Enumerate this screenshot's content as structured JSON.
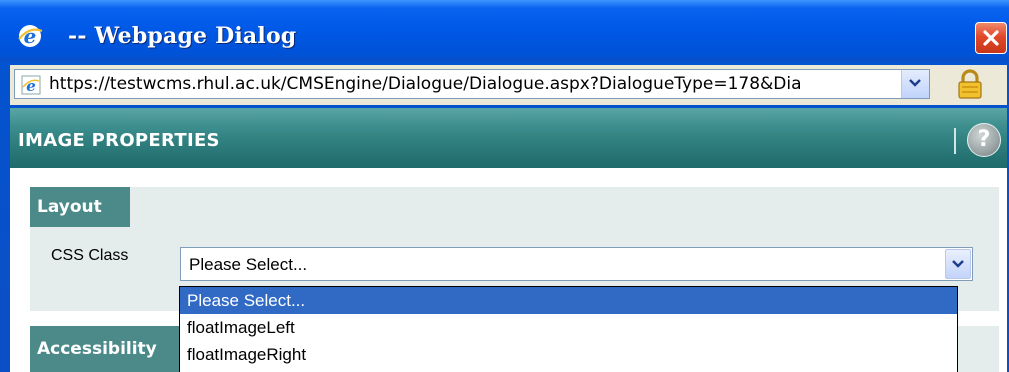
{
  "window": {
    "title": "-- Webpage Dialog",
    "close_icon": "close-icon",
    "app_icon": "internet-explorer-icon"
  },
  "address_bar": {
    "url": "https://testwcms.rhul.ac.uk/CMSEngine/Dialogue/Dialogue.aspx?DialogueType=178&Dia",
    "page_icon": "internet-explorer-page-icon",
    "security_icon": "padlock-icon"
  },
  "dialog": {
    "title": "IMAGE PROPERTIES",
    "help_label": "?",
    "help_icon": "help-icon"
  },
  "layout_section": {
    "heading": "Layout",
    "css_class_label": "CSS Class",
    "css_class_value": "Please Select...",
    "options": [
      "Please Select...",
      "floatImageLeft",
      "floatImageRight"
    ],
    "selected_index": 0
  },
  "accessibility_section": {
    "heading": "Accessibility"
  },
  "colors": {
    "titlebar": "#0054e3",
    "header_teal": "#2a7878",
    "panel_tab": "#4c8a8a",
    "panel_bg": "#e5ecec",
    "selection": "#316ac5"
  }
}
